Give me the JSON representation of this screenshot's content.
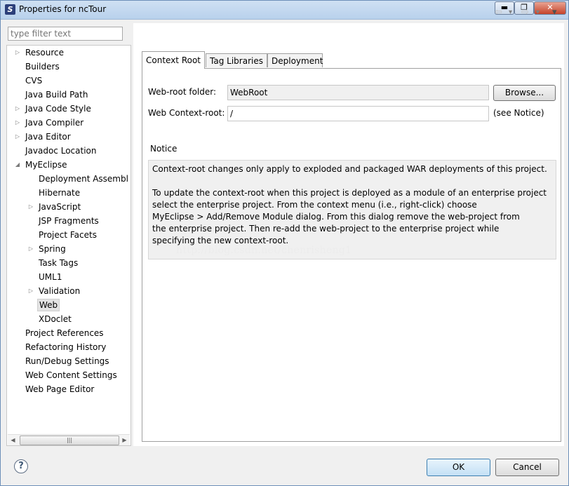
{
  "window": {
    "title": "Properties for ncTour",
    "minimize_glyph": "▬",
    "maximize_glyph": "❐",
    "close_glyph": "✕"
  },
  "sidebar": {
    "filter_placeholder": "type filter text",
    "items": [
      {
        "label": "Resource",
        "expandable": true
      },
      {
        "label": "Builders"
      },
      {
        "label": "CVS"
      },
      {
        "label": "Java Build Path"
      },
      {
        "label": "Java Code Style",
        "expandable": true
      },
      {
        "label": "Java Compiler",
        "expandable": true
      },
      {
        "label": "Java Editor",
        "expandable": true
      },
      {
        "label": "Javadoc Location"
      },
      {
        "label": "MyEclipse",
        "expanded": true
      },
      {
        "label": "Deployment Assembl"
      },
      {
        "label": "Hibernate"
      },
      {
        "label": "JavaScript",
        "expandable": true
      },
      {
        "label": "JSP Fragments"
      },
      {
        "label": "Project Facets"
      },
      {
        "label": "Spring",
        "expandable": true
      },
      {
        "label": "Task Tags"
      },
      {
        "label": "UML1"
      },
      {
        "label": "Validation",
        "expandable": true
      },
      {
        "label": "Web",
        "selected": true
      },
      {
        "label": "XDoclet"
      },
      {
        "label": "Project References"
      },
      {
        "label": "Refactoring History"
      },
      {
        "label": "Run/Debug Settings"
      },
      {
        "label": "Web Content Settings"
      },
      {
        "label": "Web Page Editor"
      }
    ],
    "scroll_left": "◀",
    "scroll_right": "▶",
    "scroll_grip": "|||"
  },
  "nav": {
    "back": "⇦",
    "back_menu": "▾",
    "forward": "⇨",
    "forward_menu": "▾",
    "view_menu": "▾"
  },
  "tabs": [
    {
      "label": "Context Root",
      "active": true
    },
    {
      "label": "Tag Libraries"
    },
    {
      "label": "Deployment"
    }
  ],
  "form": {
    "webroot_label": "Web-root folder:",
    "webroot_value": "WebRoot",
    "browse_label": "Browse...",
    "context_label": "Web Context-root:",
    "context_value": "/",
    "see_notice": "(see Notice)"
  },
  "notice": {
    "heading": "Notice",
    "line1": "Context-root changes only apply to exploded and packaged WAR deployments of this project.",
    "line2": "To update the context-root when this project is deployed as a module of an enterprise project",
    "line3": "select the enterprise project. From the context menu (i.e., right-click) choose",
    "line4": "MyEclipse > Add/Remove Module dialog. From this dialog remove the web-project from",
    "line5": "the enterprise project. Then re-add the web-project to the enterprise project while",
    "line6": "specifying the new context-root.",
    "watermark": "http://blog.csdn.net/chenrisheng1"
  },
  "footer": {
    "help_glyph": "?",
    "ok_label": "OK",
    "cancel_label": "Cancel"
  },
  "colors": {
    "titlebar": "#b8d1ec",
    "primary_button": "#c4e0f5",
    "close_button": "#c6432a"
  }
}
